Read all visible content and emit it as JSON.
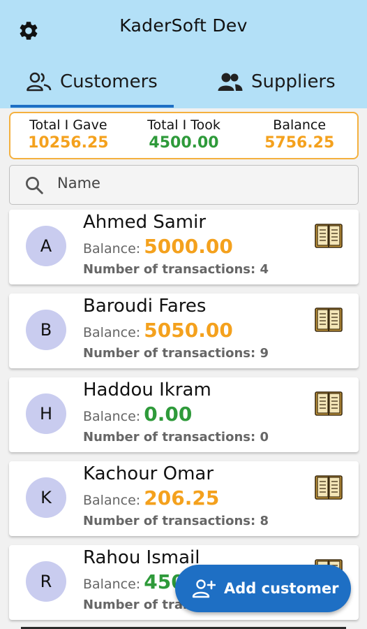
{
  "header": {
    "title": "KaderSoft Dev",
    "settings_icon": "gear-icon"
  },
  "tabs": [
    {
      "label": "Customers",
      "icon": "people-icon",
      "selected": true
    },
    {
      "label": "Suppliers",
      "icon": "people-icon",
      "selected": false
    }
  ],
  "summary": {
    "gave_label": "Total I Gave",
    "gave_value": "10256.25",
    "took_label": "Total I Took",
    "took_value": "4500.00",
    "balance_label": "Balance",
    "balance_value": "5756.25"
  },
  "search": {
    "placeholder": "Name",
    "icon": "search-icon"
  },
  "customers": [
    {
      "initial": "A",
      "name": "Ahmed Samir",
      "balance_label": "Balance:",
      "balance": "5000.00",
      "tx_label": "Number of transactions: 4"
    },
    {
      "initial": "B",
      "name": "Baroudi Fares",
      "balance_label": "Balance:",
      "balance": "5050.00",
      "tx_label": "Number of transactions: 9"
    },
    {
      "initial": "H",
      "name": "Haddou Ikram",
      "balance_label": "Balance:",
      "balance": "0.00",
      "tx_label": "Number of transactions: 0"
    },
    {
      "initial": "K",
      "name": "Kachour Omar",
      "balance_label": "Balance:",
      "balance": "206.25",
      "tx_label": "Number of transactions: 8"
    },
    {
      "initial": "R",
      "name": "Rahou Ismail",
      "balance_label": "Balance:",
      "balance": "450",
      "tx_label": "Number of tran"
    }
  ],
  "fab": {
    "label": "Add customer",
    "icon": "add-person-icon"
  },
  "colors": {
    "accent": "#1e6fc4",
    "orange": "#f4a11d",
    "green": "#2e9a3a",
    "header_bg": "#b3e0f7",
    "avatar_bg": "#c9ccef"
  }
}
